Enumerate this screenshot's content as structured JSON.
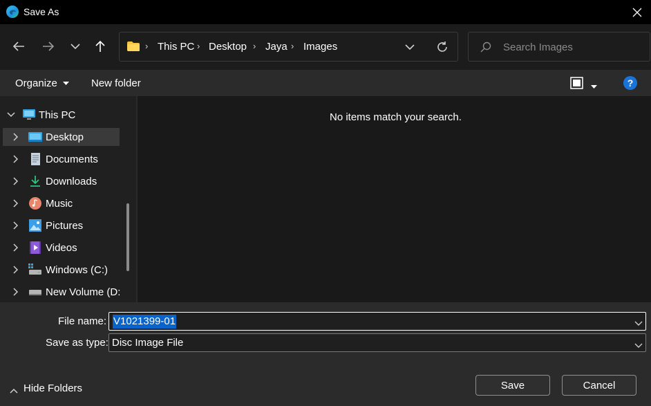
{
  "window": {
    "title": "Save As",
    "app_icon": "edge-browser-icon",
    "close_icon": "close-icon"
  },
  "nav": {
    "back_icon": "arrow-left-icon",
    "forward_icon": "arrow-right-icon",
    "recent_icon": "chevron-down-icon",
    "up_icon": "arrow-up-icon",
    "refresh_icon": "refresh-icon",
    "breadcrumb": [
      "This PC",
      "Desktop",
      "Jaya",
      "Images"
    ],
    "search_placeholder": "Search Images"
  },
  "commands": {
    "organize": "Organize",
    "new_folder": "New folder"
  },
  "tree": {
    "root": "This PC",
    "items": [
      {
        "label": "Desktop",
        "icon": "desktop-icon",
        "selected": true
      },
      {
        "label": "Documents",
        "icon": "documents-icon"
      },
      {
        "label": "Downloads",
        "icon": "downloads-icon"
      },
      {
        "label": "Music",
        "icon": "music-icon"
      },
      {
        "label": "Pictures",
        "icon": "pictures-icon"
      },
      {
        "label": "Videos",
        "icon": "videos-icon"
      },
      {
        "label": "Windows (C:)",
        "icon": "drive-windows-icon"
      },
      {
        "label": "New Volume (D:",
        "icon": "drive-icon"
      }
    ]
  },
  "content": {
    "empty_message": "No items match your search."
  },
  "form": {
    "file_name_label": "File name:",
    "file_name_value": "V1021399-01",
    "save_type_label": "Save as type:",
    "save_type_value": "Disc Image File"
  },
  "buttons": {
    "save": "Save",
    "cancel": "Cancel",
    "hide_folders": "Hide Folders"
  },
  "colors": {
    "accent": "#0a63c9",
    "help_icon_bg": "#1a73d9",
    "folder_yellow": "#f4c542"
  }
}
